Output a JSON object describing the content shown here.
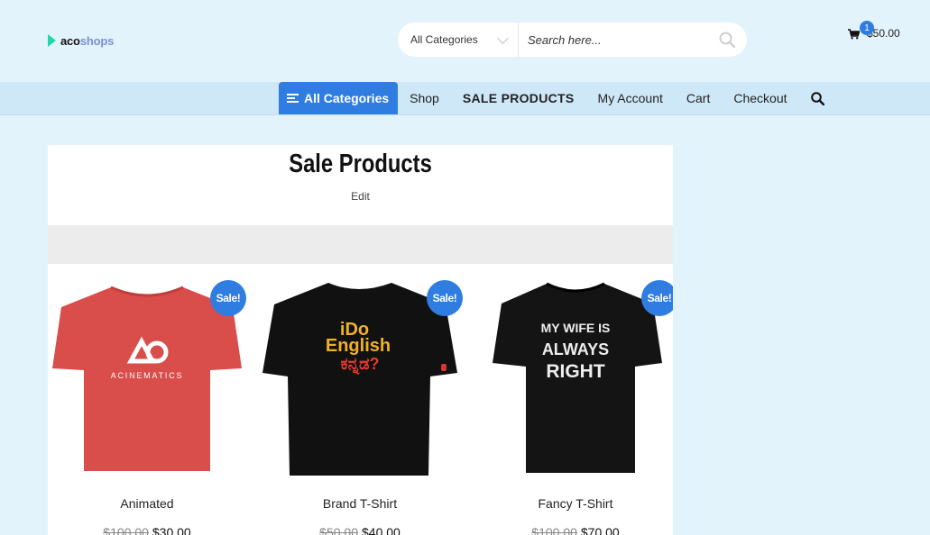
{
  "brand": {
    "part1": "aco",
    "part2": "shops"
  },
  "search": {
    "category": "All Categories",
    "placeholder": "Search here..."
  },
  "cart": {
    "count": "1",
    "total": "$50.00"
  },
  "nav": {
    "all_categories": "All Categories",
    "items": [
      "Shop",
      "SALE PRODUCTS",
      "My Account",
      "Cart",
      "Checkout"
    ]
  },
  "page": {
    "title": "Sale Products",
    "edit": "Edit"
  },
  "products": [
    {
      "name": "Animated",
      "old_price": "$100.00",
      "price": "$30.00",
      "badge": "Sale!",
      "shirt_color": "#d94d4b",
      "print": [
        "ACINEMATICS"
      ]
    },
    {
      "name": "Brand T-Shirt",
      "old_price": "$50.00",
      "price": "$40.00",
      "badge": "Sale!",
      "shirt_color": "#111111",
      "print": [
        "iDo",
        "English"
      ]
    },
    {
      "name": "Fancy T-Shirt",
      "old_price": "$100.00",
      "price": "$70.00",
      "badge": "Sale!",
      "shirt_color": "#141414",
      "print": [
        "MY WIFE IS",
        "ALWAYS",
        "RIGHT"
      ]
    }
  ],
  "colors": {
    "accent": "#2f7de1",
    "background": "#e3f3fc",
    "nav_bg": "#cfe8f8"
  }
}
